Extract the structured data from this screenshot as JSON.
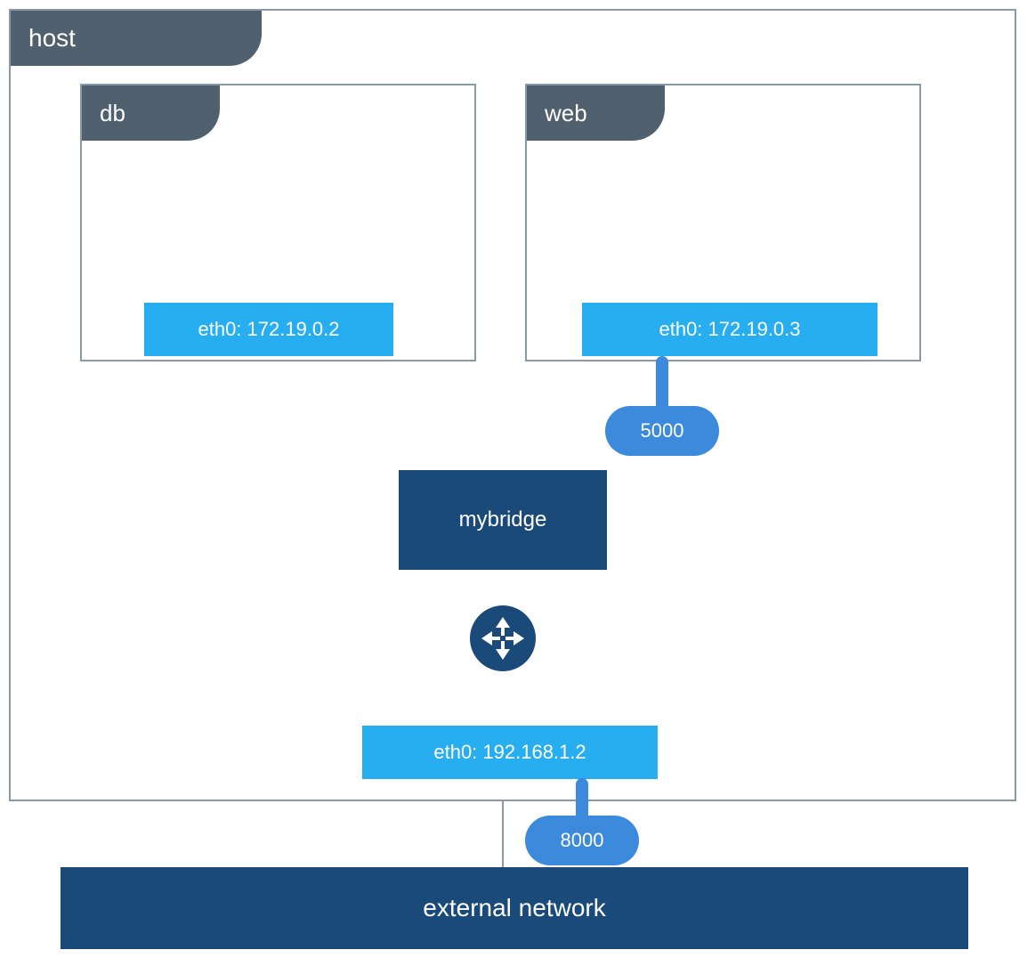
{
  "colors": {
    "tab_bg": "#51606f",
    "box_border": "#8a99a8",
    "eth_bg": "#27aef0",
    "dark_blue": "#1a4a7a",
    "port_pill": "#3b8adb",
    "connector": "#8a99a8"
  },
  "host": {
    "label": "host",
    "interface": "eth0: 192.168.1.2"
  },
  "containers": {
    "db": {
      "label": "db",
      "interface": "eth0: 172.19.0.2"
    },
    "web": {
      "label": "web",
      "interface": "eth0: 172.19.0.3",
      "exposed_port": "5000"
    }
  },
  "bridge": {
    "label": "mybridge"
  },
  "external": {
    "label": "external network",
    "mapped_port": "8000"
  },
  "router_icon": "nat-router-icon"
}
